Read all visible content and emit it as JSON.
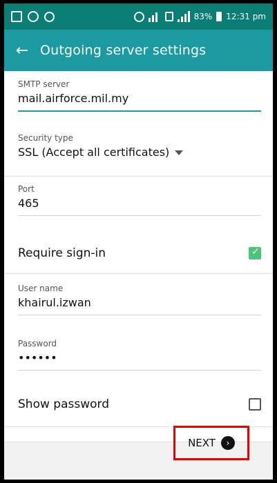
{
  "status_bar": {
    "battery_percent": "83%",
    "time": "12:31 pm"
  },
  "appbar": {
    "title": "Outgoing server settings",
    "back_icon": "arrow-left-icon"
  },
  "form": {
    "smtp_server": {
      "label": "SMTP server",
      "value": "mail.airforce.mil.my"
    },
    "security_type": {
      "label": "Security type",
      "value": "SSL (Accept all certificates)"
    },
    "port": {
      "label": "Port",
      "value": "465"
    },
    "require_sign_in": {
      "label": "Require sign-in",
      "checked": true
    },
    "username": {
      "label": "User name",
      "value": "khairul.izwan"
    },
    "password": {
      "label": "Password",
      "value": "••••••"
    },
    "show_password": {
      "label": "Show password",
      "checked": false
    }
  },
  "actions": {
    "next_label": "NEXT"
  },
  "colors": {
    "status_bar": "#0a7d74",
    "appbar": "#1b9aa1",
    "checkbox_checked": "#4cc478",
    "highlight": "#e00000"
  }
}
